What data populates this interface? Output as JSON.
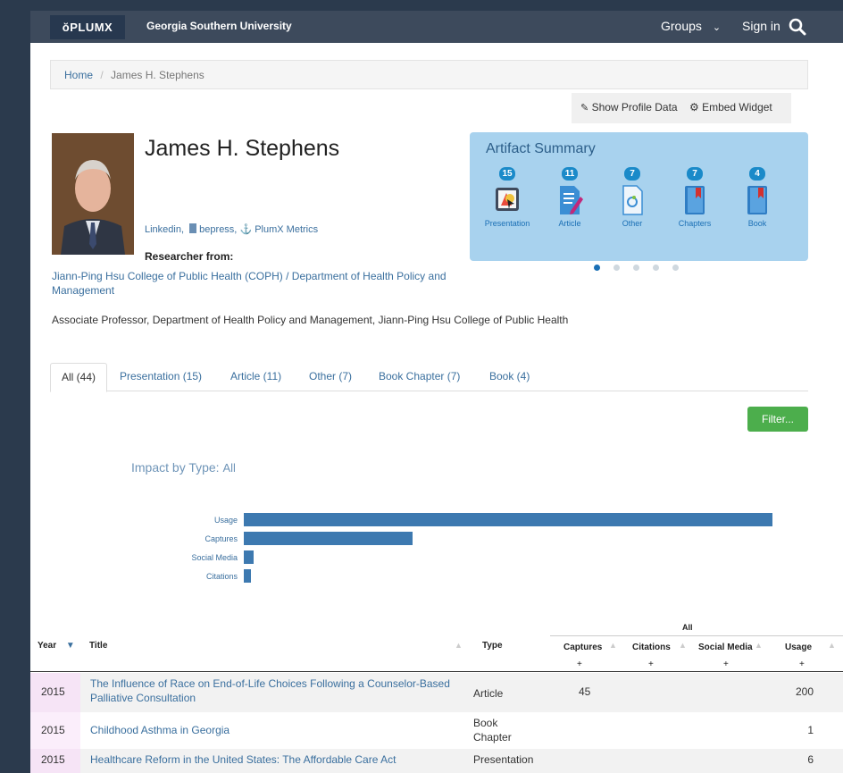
{
  "header": {
    "logo": "ŏPLUMX",
    "institution": "Georgia Southern University",
    "groups": "Groups",
    "signin": "Sign in"
  },
  "breadcrumb": {
    "home": "Home",
    "sep": "/",
    "current": "James H. Stephens"
  },
  "profile_buttons": {
    "show_profile": "Show Profile Data",
    "embed": "Embed Widget"
  },
  "profile": {
    "name": "James H. Stephens",
    "link_linkedin": "Linkedin,",
    "link_bepress": "bepress,",
    "link_plumx": "PlumX Metrics",
    "researcher_from_label": "Researcher from:",
    "researcher_from": "Jiann-Ping Hsu College of Public Health (COPH) / Department of Health Policy and Management",
    "role": "Associate Professor, Department of Health Policy and Management, Jiann-Ping Hsu College of Public Health"
  },
  "artifact_summary": {
    "title": "Artifact Summary",
    "items": [
      {
        "count": "15",
        "label": "Presentation",
        "icon": "presentation-icon"
      },
      {
        "count": "11",
        "label": "Article",
        "icon": "article-icon"
      },
      {
        "count": "7",
        "label": "Other",
        "icon": "other-icon"
      },
      {
        "count": "7",
        "label": "Chapters",
        "icon": "chapters-icon"
      },
      {
        "count": "4",
        "label": "Book",
        "icon": "book-icon"
      }
    ]
  },
  "tabs": [
    {
      "label": "All (44)"
    },
    {
      "label": "Presentation (15)"
    },
    {
      "label": "Article (11)"
    },
    {
      "label": "Other (7)"
    },
    {
      "label": "Book Chapter (7)"
    },
    {
      "label": "Book (4)"
    }
  ],
  "filter_button": "Filter...",
  "impact": {
    "title": "Impact by Type:",
    "selected": "All"
  },
  "chart_data": {
    "type": "bar",
    "orientation": "horizontal",
    "categories": [
      "Usage",
      "Captures",
      "Social Media",
      "Citations"
    ],
    "values": [
      1000,
      320,
      18,
      14
    ],
    "grid": false
  },
  "table": {
    "group_header": "All",
    "headers": {
      "year": "Year",
      "title": "Title",
      "type": "Type",
      "captures": "Captures",
      "citations": "Citations",
      "social": "Social Media",
      "usage": "Usage",
      "plus": "+"
    },
    "rows": [
      {
        "year": "2015",
        "title": "The Influence of Race on End-of-Life Choices Following a Counselor-Based Palliative Consultation",
        "type": "Article",
        "captures": "45",
        "citations": "",
        "social": "",
        "usage": "200"
      },
      {
        "year": "2015",
        "title": "Childhood Asthma in Georgia",
        "type": "Book Chapter",
        "captures": "",
        "citations": "",
        "social": "",
        "usage": "1"
      },
      {
        "year": "2015",
        "title": "Healthcare Reform in the United States: The Affordable Care Act",
        "type": "Presentation",
        "captures": "",
        "citations": "",
        "social": "",
        "usage": "6"
      }
    ]
  }
}
